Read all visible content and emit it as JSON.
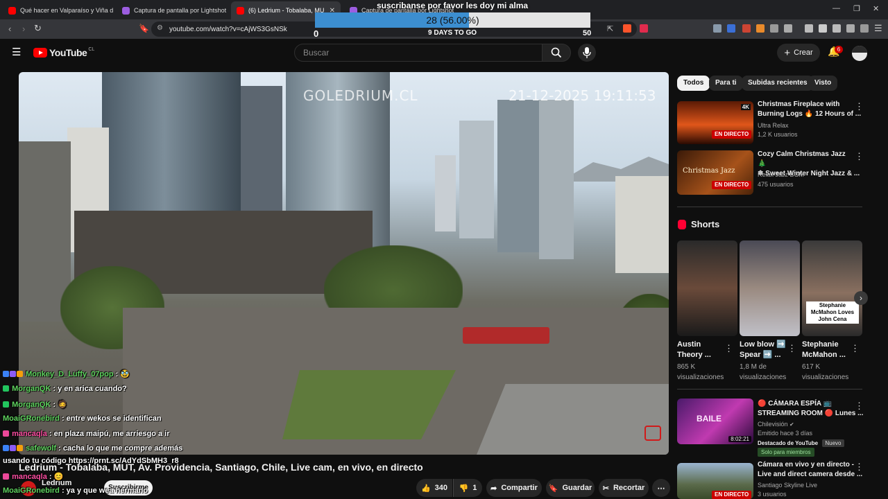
{
  "browser": {
    "tabs": [
      {
        "label": "Qué hacer en Valparaíso y Viña d",
        "favicon_color": "#ff0000"
      },
      {
        "label": "Captura de pantalla por Lightshot",
        "favicon_color": "#9c5de0"
      },
      {
        "label": "(6) Ledrium - Tobalaba, MUT, Av.",
        "favicon_color": "#ff0000"
      },
      {
        "label": "Captura de pantalla por Lightshot",
        "favicon_color": "#9c5de0"
      }
    ],
    "url": "youtube.com/watch?v=cAjWS3GsNSk"
  },
  "goal_overlay": {
    "title": "suscribanse por favor les doy mi alma",
    "current": 28,
    "target": 50,
    "min": "0",
    "max": "50",
    "percent_text": "28 (56.00%)",
    "percent": 0.56,
    "days_left": "9 DAYS TO GO"
  },
  "header": {
    "logo_text": "YouTube",
    "country": "CL",
    "search_placeholder": "Buscar",
    "create_label": "Crear",
    "notification_count": "6"
  },
  "video": {
    "osd_brand": "GOLEDRIUM.CL",
    "osd_timestamp": "21-12-2025 19:11:53",
    "title": "Ledrium - Tobalaba, MUT, Av. Providencia, Santiago, Chile, Live cam, en vivo, en directo",
    "channel": "Ledrium",
    "subscribe_label": "Suscribirme",
    "likes": "340",
    "dislikes": "1",
    "share_label": "Compartir",
    "save_label": "Guardar",
    "clip_label": "Recortar"
  },
  "chat": [
    {
      "user": "Monkey_D_Luffy_07pop",
      "sep": " : ",
      "message": "🥸",
      "color": "#5fd35f"
    },
    {
      "user": "MorganQK",
      "sep": " : ",
      "message": "y en arica cuando?",
      "color": "#5fd35f"
    },
    {
      "user": "MorganQK",
      "sep": " : ",
      "message": "🧔",
      "color": "#5fd35f"
    },
    {
      "user": "MoaiGRonebird",
      "sep": " : ",
      "message": "entre wekos se identifican",
      "color": "#5fd35f"
    },
    {
      "user": "mancaqla",
      "sep": " : ",
      "message": "en plaza maipú, me arriesgo a ir",
      "color": "#ff4fa3"
    },
    {
      "user": "safewolf",
      "sep": " : ",
      "message": "cacha lo que me compre además",
      "color": "#5fd35f"
    },
    {
      "user": "",
      "sep": "",
      "message": "usando tu código https://prnt.sc/AdYdSbMH3_r8",
      "color": "#ffffff"
    },
    {
      "user": "mancaqla",
      "sep": " : ",
      "message": "😊",
      "color": "#ff4fa3"
    },
    {
      "user": "MoaiGRonebird",
      "sep": " : ",
      "message": "ya y que wea hermano",
      "color": "#5fd35f"
    }
  ],
  "sidebar": {
    "chips": [
      "Todos",
      "Para ti",
      "Subidas recientes",
      "Visto"
    ],
    "recommended": [
      {
        "title_line1": "Christmas Fireplace with",
        "title_line2": "Burning Logs 🔥 12 Hours of ...",
        "channel": "Ultra Relax",
        "meta": "1,2 K usuarios",
        "badge": "EN DIRECTO",
        "thumb_text": "4K"
      },
      {
        "title_line1": "Cozy Calm Christmas Jazz 🎄",
        "title_line2": "❄ Sweet Winter Night Jazz & ...",
        "channel": "Relax Jazz BGM",
        "meta": "475 usuarios",
        "badge": "EN DIRECTO",
        "thumb_text": "Christmas Jazz"
      }
    ],
    "shorts_header": "Shorts",
    "shorts": [
      {
        "title_line1": "Austin",
        "title_line2": "Theory ...",
        "views_line1": "865 K",
        "views_line2": "visualizaciones"
      },
      {
        "title_line1": "Low blow ➡️",
        "title_line2": "Spear ➡️ ...",
        "views_line1": "1,8 M de",
        "views_line2": "visualizaciones"
      },
      {
        "title_line1": "Stephanie",
        "title_line2": "McMahon ...",
        "views_line1": "617 K",
        "views_line2": "visualizaciones",
        "thumb_caption": "Stephanie McMahon Loves John Cena"
      }
    ],
    "more_recommended": [
      {
        "title_line1": "🔴 CÁMARA ESPÍA 📺",
        "title_line2": "STREAMING ROOM 🔴 Lunes ...",
        "channel": "Chilevisión",
        "meta": "Emitido hace 3 días",
        "extra": "Destacado de YouTube",
        "tag": "Nuevo",
        "members": "Solo para miembros",
        "duration": "8:02:21",
        "thumb_text": "BAILE"
      },
      {
        "title_line1": "Cámara en vivo y en directo -",
        "title_line2": "Live and direct camera desde ...",
        "channel": "Santiago Skyline Live",
        "meta": "3 usuarios",
        "badge": "EN DIRECTO"
      }
    ]
  }
}
